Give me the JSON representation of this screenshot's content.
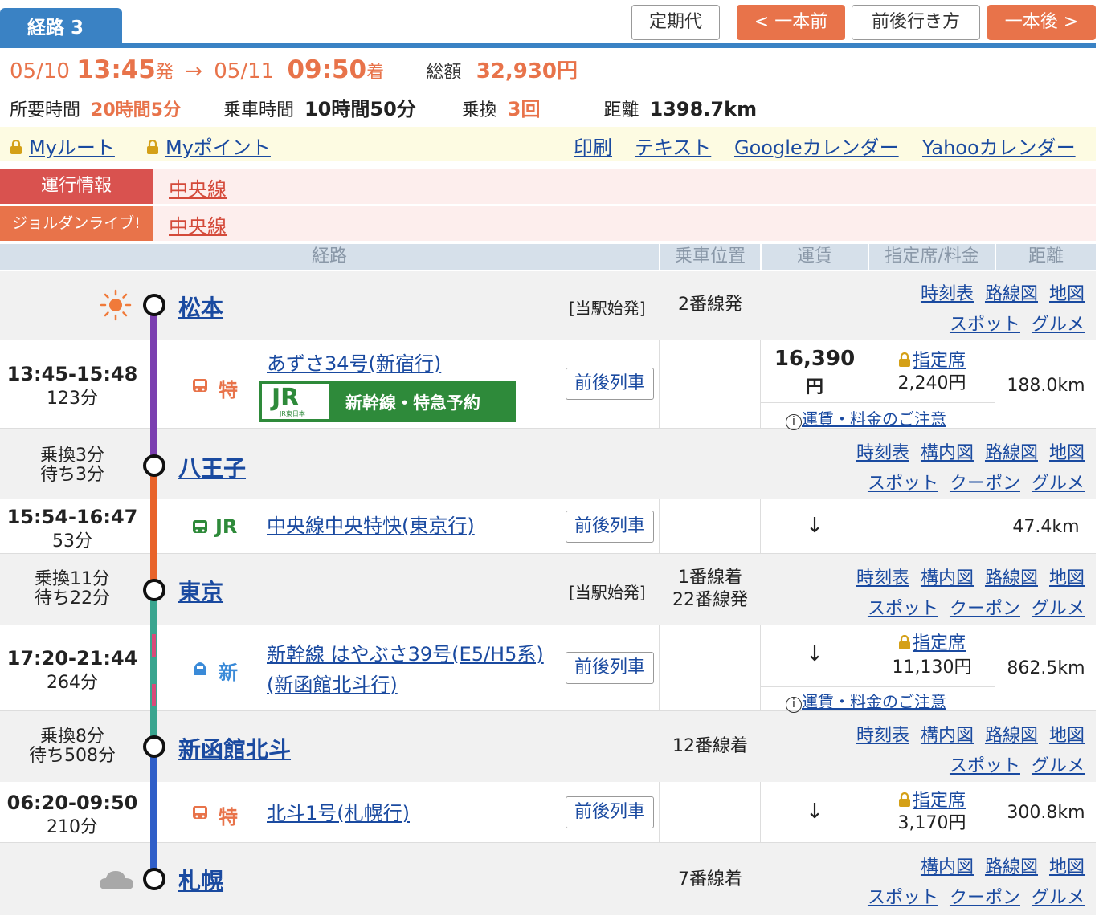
{
  "header": {
    "route_tab": "経路 3",
    "buttons": {
      "commuter": "定期代",
      "prev": "一本前",
      "around": "前後行き方",
      "next": "一本後"
    },
    "depart_date": "05/10",
    "depart_time": "13:45",
    "depart_suffix": "発",
    "arrow": "→",
    "arrive_date": "05/11",
    "arrive_time": "09:50",
    "arrive_suffix": "着",
    "total_label": "総額",
    "total_value": "32,930円",
    "required_label": "所要時間",
    "required_value": "20時間5分",
    "ride_label": "乗車時間",
    "ride_value": "10時間50分",
    "transfer_label": "乗換",
    "transfer_value": "3回",
    "distance_label": "距離",
    "distance_value": "1398.7km"
  },
  "links": {
    "my_route": "Myルート",
    "my_point": "Myポイント",
    "print": "印刷",
    "text": "テキスト",
    "google": "Googleカレンダー",
    "yahoo": "Yahooカレンダー"
  },
  "info": [
    {
      "tag": "運行情報",
      "line": "中央線",
      "color": "#d9524f"
    },
    {
      "tag": "ジョルダンライブ!",
      "line": "中央線",
      "color": "#e8734a"
    }
  ],
  "columns": {
    "route": "経路",
    "position": "乗車位置",
    "fare": "運賃",
    "seat": "指定席/料金",
    "distance": "距離"
  },
  "stations": {
    "matsumoto": {
      "name": "松本",
      "note": "[当駅始発]",
      "platform": "2番線発",
      "links": [
        "時刻表",
        "路線図",
        "地図"
      ],
      "links2": [
        "スポット",
        "グルメ"
      ]
    },
    "hachioji": {
      "name": "八王子",
      "wait1": "乗換3分",
      "wait2": "待ち3分",
      "links": [
        "時刻表",
        "構内図",
        "路線図",
        "地図"
      ],
      "links2": [
        "スポット",
        "クーポン",
        "グルメ"
      ]
    },
    "tokyo": {
      "name": "東京",
      "wait1": "乗換11分",
      "wait2": "待ち22分",
      "note": "[当駅始発]",
      "platform1": "1番線着",
      "platform2": "22番線発",
      "links": [
        "時刻表",
        "構内図",
        "路線図",
        "地図"
      ],
      "links2": [
        "スポット",
        "クーポン",
        "グルメ"
      ]
    },
    "shinhakodate": {
      "name": "新函館北斗",
      "wait1": "乗換8分",
      "wait2": "待ち508分",
      "platform": "12番線着",
      "links": [
        "時刻表",
        "構内図",
        "路線図",
        "地図"
      ],
      "links2": [
        "スポット",
        "グルメ"
      ]
    },
    "sapporo": {
      "name": "札幌",
      "platform": "7番線着",
      "links": [
        "構内図",
        "路線図",
        "地図"
      ],
      "links2": [
        "スポット",
        "クーポン",
        "グルメ"
      ]
    }
  },
  "trains": {
    "t1": {
      "time": "13:45-15:48",
      "dur": "123分",
      "kind": "特",
      "name": "あずさ34号(新宿行)",
      "banner": "新幹線・特急予約",
      "jr_small": "JR東日本",
      "adj": "前後列車",
      "fare1": "16,390",
      "fare2": "円",
      "seat": "指定席",
      "seat_fee": "2,240円",
      "caution": "運賃・料金のご注意",
      "dist": "188.0km"
    },
    "t2": {
      "time": "15:54-16:47",
      "dur": "53分",
      "kind": "JR",
      "name": "中央線中央特快(東京行)",
      "adj": "前後列車",
      "fare": "↓",
      "dist": "47.4km"
    },
    "t3": {
      "time": "17:20-21:44",
      "dur": "264分",
      "kind": "新",
      "name1": "新幹線 はやぶさ39号(E5/H5系)",
      "name2": "(新函館北斗行)",
      "adj": "前後列車",
      "fare": "↓",
      "seat": "指定席",
      "seat_fee": "11,130円",
      "caution": "運賃・料金のご注意",
      "dist": "862.5km"
    },
    "t4": {
      "time": "06:20-09:50",
      "dur": "210分",
      "kind": "特",
      "name": "北斗1号(札幌行)",
      "adj": "前後列車",
      "fare": "↓",
      "seat": "指定席",
      "seat_fee": "3,170円",
      "dist": "300.8km"
    }
  },
  "colors": {
    "accent": "#e8734a",
    "blue": "#3a82c4",
    "link": "#1a4aa0",
    "line_purple": "#7b3fb0",
    "line_orange": "#e8632a",
    "line_teal": "#3aa58f",
    "line_blue": "#2f5ec8",
    "jr_green": "#2e8a3a"
  }
}
